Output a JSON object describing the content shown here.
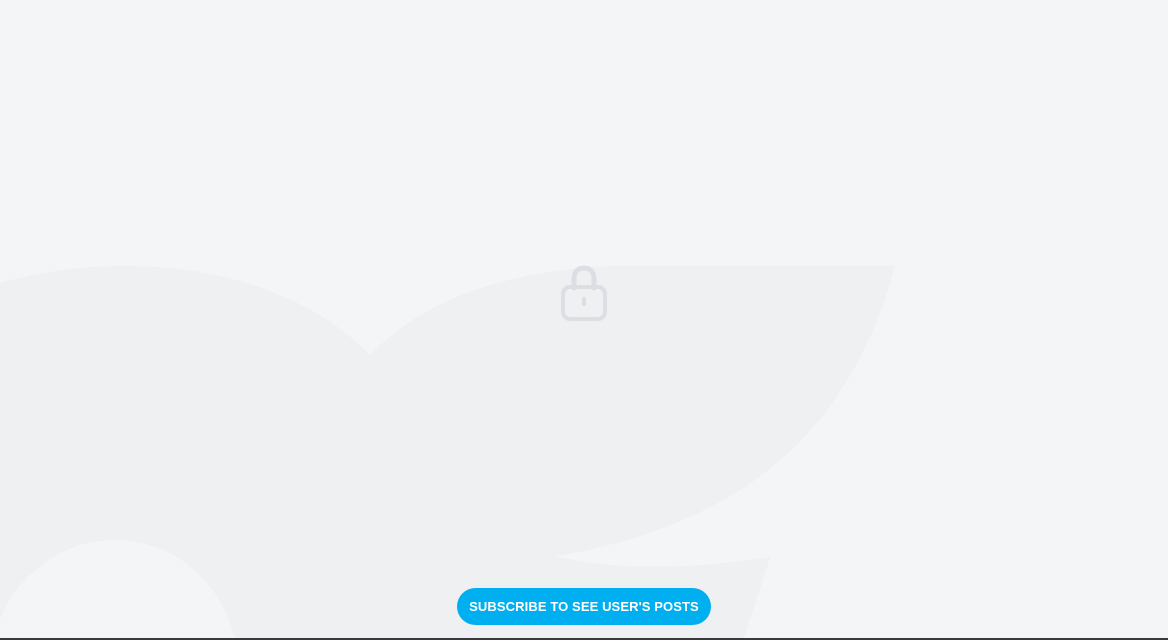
{
  "locked_content": {
    "icon": "lock-icon",
    "subscribe_button_label": "SUBSCRIBE TO SEE USER'S POSTS"
  },
  "colors": {
    "background": "#f4f5f7",
    "watermark": "#eef0f2",
    "lock_icon": "#d9dbe0",
    "accent": "#00aff0",
    "button_text": "#ffffff"
  }
}
